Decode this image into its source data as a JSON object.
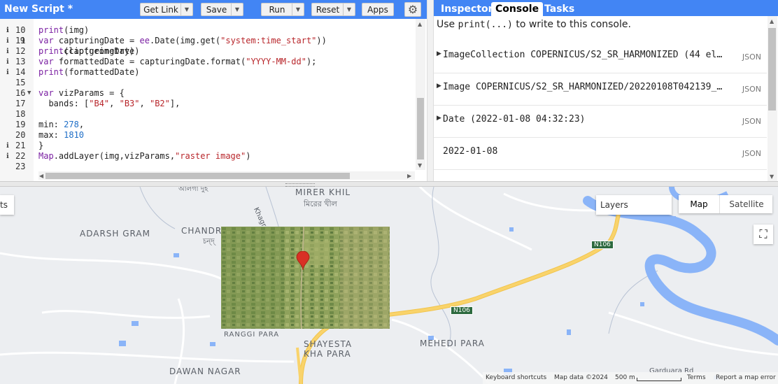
{
  "editor": {
    "title": "New Script *",
    "buttons": {
      "get_link": "Get Link",
      "save": "Save",
      "run": "Run",
      "reset": "Reset",
      "apps": "Apps"
    },
    "partial_top_line": "    .clip(geometry)",
    "partial_top_line_number": "9",
    "lines": [
      {
        "n": "10",
        "text": "print(img)"
      },
      {
        "n": "11",
        "text": "var capturingDate = ee.Date(img.get(\"system:time_start\"))"
      },
      {
        "n": "12",
        "text": "print(capturingDate)"
      },
      {
        "n": "13",
        "text": "var formattedDate = capturingDate.format(\"YYYY-MM-dd\");"
      },
      {
        "n": "14",
        "text": "print(formattedDate)"
      },
      {
        "n": "15",
        "text": ""
      },
      {
        "n": "16",
        "text": "var vizParams = {"
      },
      {
        "n": "17",
        "text": "  bands: [\"B4\", \"B3\", \"B2\"],"
      },
      {
        "n": "18",
        "text": ""
      },
      {
        "n": "19",
        "text": "min: 278,"
      },
      {
        "n": "20",
        "text": "max: 1810"
      },
      {
        "n": "21",
        "text": "}"
      },
      {
        "n": "22",
        "text": "Map.addLayer(img,vizParams,\"raster image\")"
      },
      {
        "n": "23",
        "text": ""
      }
    ]
  },
  "right_panel": {
    "tabs": [
      "Inspector",
      "Console",
      "Tasks"
    ],
    "active_tab": "Console",
    "hint_prefix": "Use ",
    "hint_code": "print(...)",
    "hint_suffix": " to write to this console.",
    "entries": [
      {
        "text": "ImageCollection COPERNICUS/S2_SR_HARMONIZED (44 elem…",
        "expandable": true,
        "tag": "JSON"
      },
      {
        "text": "Image COPERNICUS/S2_SR_HARMONIZED/20220108T042139_20…",
        "expandable": true,
        "tag": "JSON"
      },
      {
        "text": "Date (2022-01-08 04:32:23)",
        "expandable": true,
        "tag": "JSON"
      },
      {
        "text": "2022-01-08",
        "expandable": false,
        "tag": "JSON"
      }
    ]
  },
  "map": {
    "layers_label": "Layers",
    "map_type": {
      "map": "Map",
      "satellite": "Satellite",
      "active": "Map"
    },
    "left_partial_label": "ts",
    "places": {
      "mirer_khil": "MIRER KHIL",
      "mirer_khil_bn": "মিরের খীল",
      "adarsh_gram": "ADARSH GRAM",
      "chandr": "CHANDR",
      "chandr_bn": "চন্দ্",
      "ranggi_para": "RANGGI PARA",
      "shayesta": "SHAYESTA",
      "kha_para": "KHA PARA",
      "mehedi_para": "MEHEDI PARA",
      "dawan_nagar": "DAWAN NAGAR",
      "khagrachari": "Khagrachari",
      "garduara_rd": "Garduara Rd",
      "top_bn": "আলগা দুহ"
    },
    "roads": {
      "n106_a": "N106",
      "n106_b": "N106"
    },
    "footer": {
      "shortcuts": "Keyboard shortcuts",
      "map_data": "Map data ©2024",
      "scale": "500 m",
      "terms": "Terms",
      "report": "Report a map error"
    },
    "colors": {
      "water": "#8ab4f8",
      "road": "#f9d36b",
      "background": "#eceef1"
    }
  }
}
